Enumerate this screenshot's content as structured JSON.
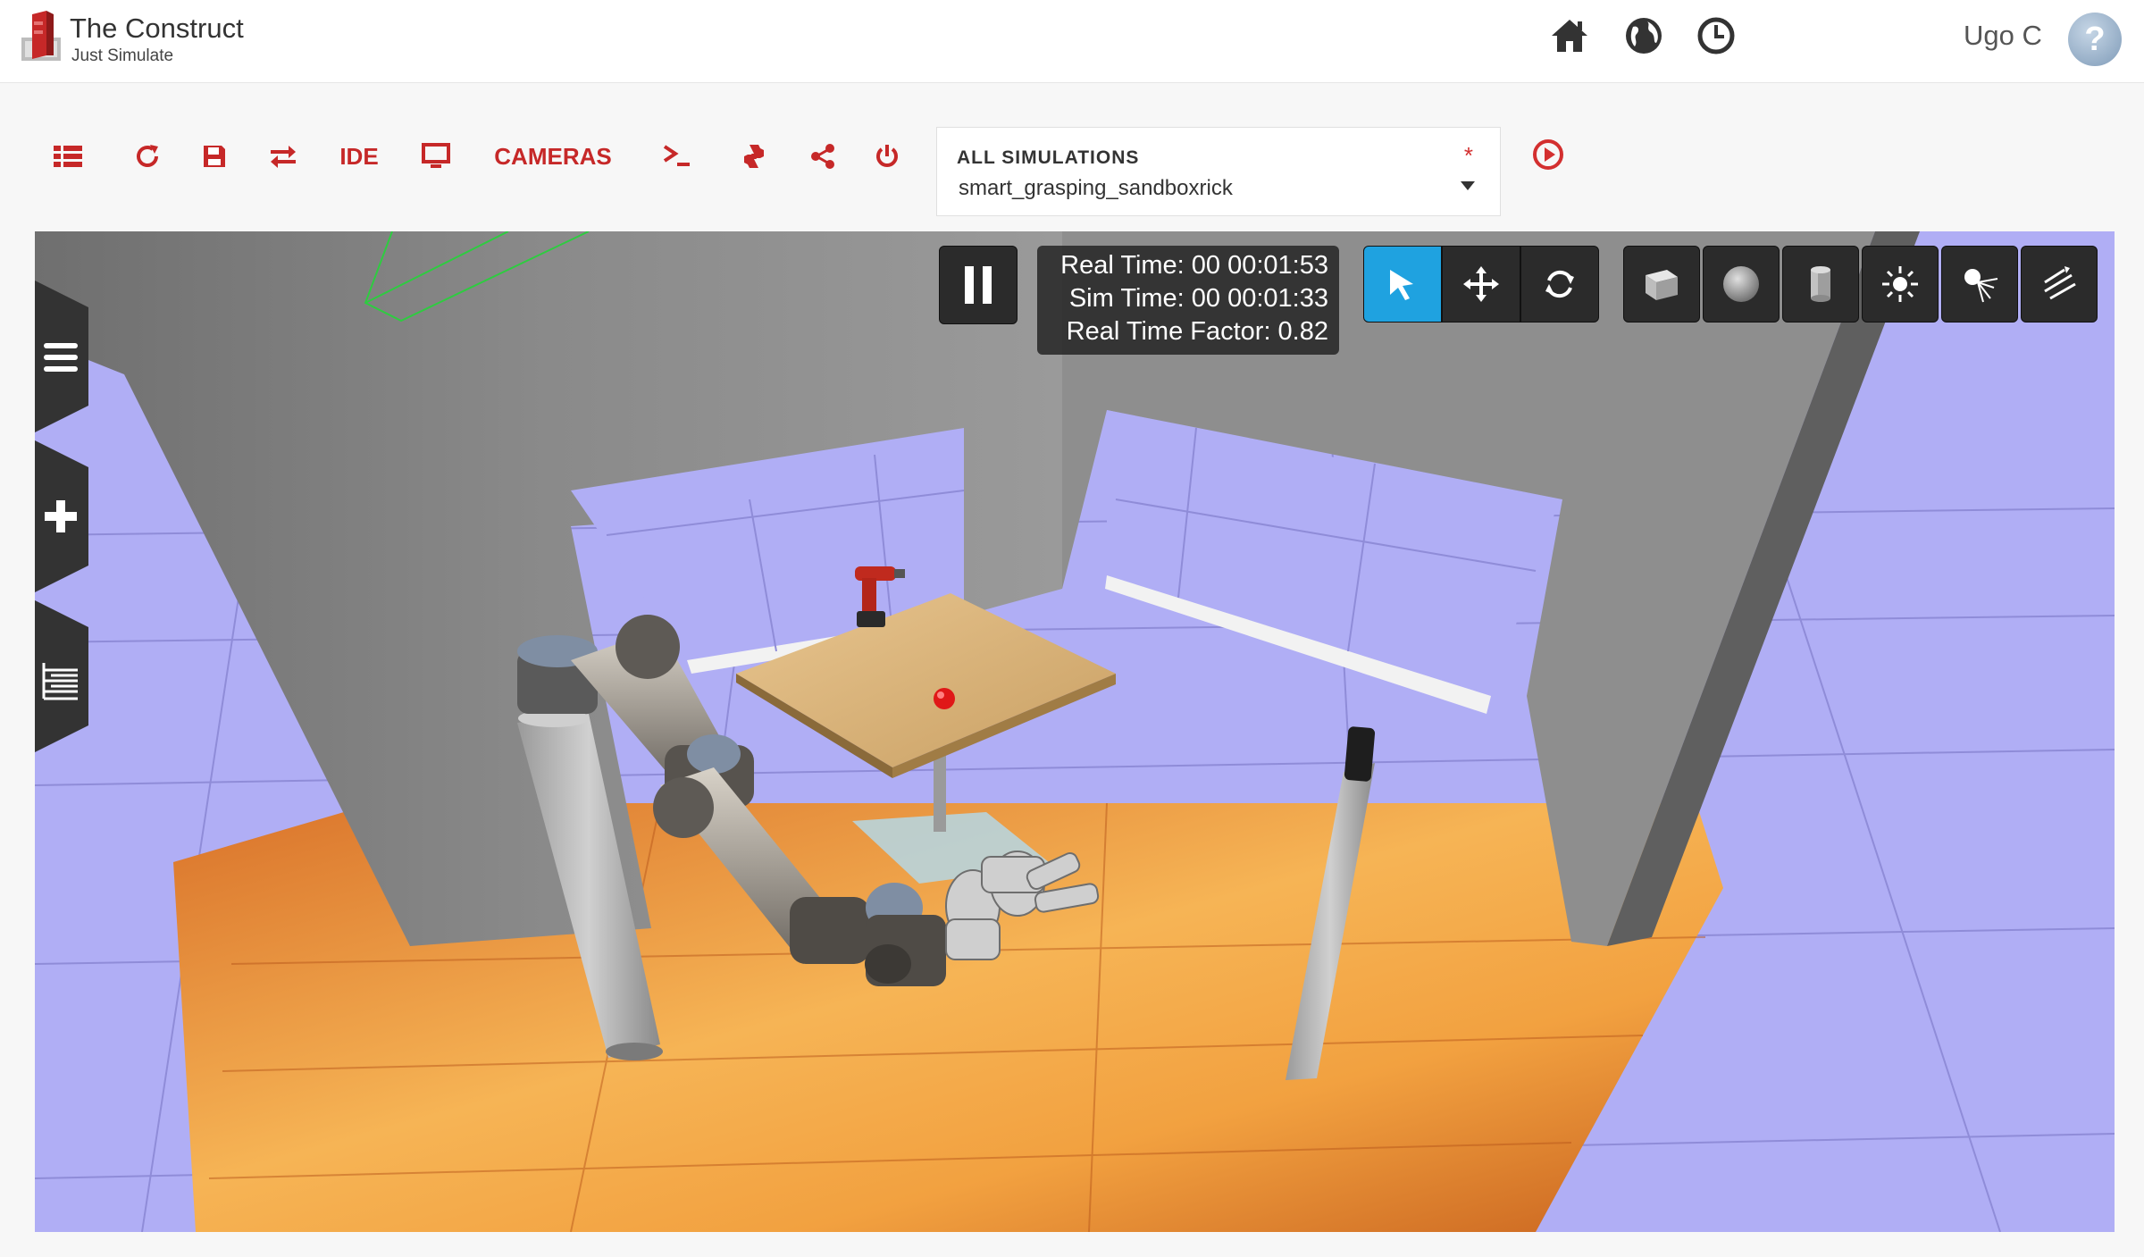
{
  "header": {
    "brand_title": "The Construct",
    "brand_subtitle": "Just Simulate",
    "user_name": "Ugo C",
    "help_label": "?",
    "icons": [
      "home-icon",
      "globe-icon",
      "clock-icon"
    ]
  },
  "toolbar": {
    "ide_label": "IDE",
    "cameras_label": "CAMERAS",
    "icons": [
      "list-icon",
      "refresh-icon",
      "save-icon",
      "swap-icon",
      "monitor-icon",
      "terminal-icon",
      "python-icon",
      "share-icon",
      "power-icon"
    ],
    "accent_color": "#c62828"
  },
  "simulation_select": {
    "label": "ALL SIMULATIONS",
    "required_mark": "*",
    "value": "smart_grasping_sandboxrick"
  },
  "viewport": {
    "pause_icon": "pause-icon",
    "real_time": "Real Time: 00 00:01:53",
    "sim_time": "Sim Time: 00 00:01:33",
    "real_time_factor": "Real Time Factor: 0.82",
    "tools": [
      "select-arrow-icon",
      "translate-icon",
      "rotate-icon"
    ],
    "shapes": [
      "box-icon",
      "sphere-icon",
      "cylinder-icon",
      "point-light-icon",
      "spot-light-icon",
      "directional-light-icon"
    ],
    "side_tabs": [
      "menu-icon",
      "insert-plus-icon",
      "tree-icon"
    ],
    "active_tool_color": "#1fa2e0"
  }
}
